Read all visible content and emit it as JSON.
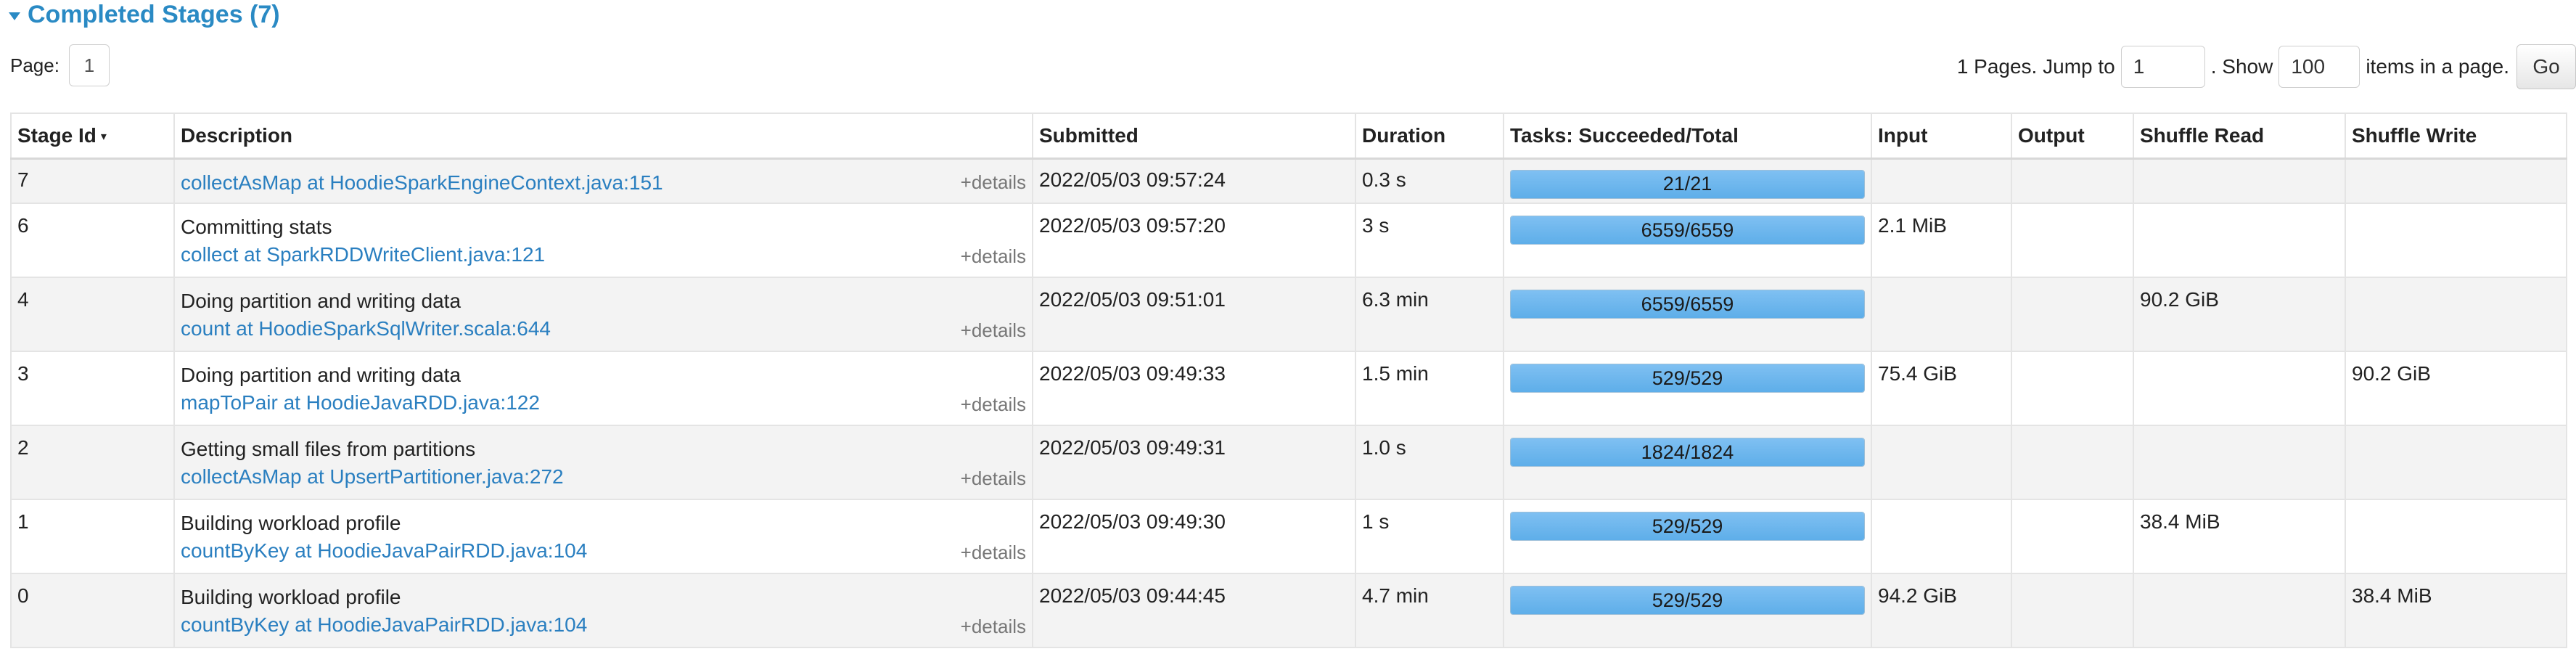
{
  "section": {
    "title": "Completed Stages (7)"
  },
  "pager": {
    "page_label": "Page:",
    "current_page": "1",
    "pages_text": "1 Pages. Jump to",
    "jump_value": "1",
    "show_text": ". Show",
    "show_value": "100",
    "items_text": "items in a page.",
    "go_label": "Go"
  },
  "table": {
    "headers": {
      "stage_id": "Stage Id",
      "sort_indicator": "▾",
      "description": "Description",
      "submitted": "Submitted",
      "duration": "Duration",
      "tasks": "Tasks: Succeeded/Total",
      "input": "Input",
      "output": "Output",
      "shuffle_read": "Shuffle Read",
      "shuffle_write": "Shuffle Write"
    },
    "details_label": "+details",
    "rows": [
      {
        "stage_id": "7",
        "title": "",
        "link": "collectAsMap at HoodieSparkEngineContext.java:151",
        "submitted": "2022/05/03 09:57:24",
        "duration": "0.3 s",
        "tasks": "21/21",
        "progress": 1.0,
        "input": "",
        "output": "",
        "shuffle_read": "",
        "shuffle_write": ""
      },
      {
        "stage_id": "6",
        "title": "Committing stats",
        "link": "collect at SparkRDDWriteClient.java:121",
        "submitted": "2022/05/03 09:57:20",
        "duration": "3 s",
        "tasks": "6559/6559",
        "progress": 1.0,
        "input": "2.1 MiB",
        "output": "",
        "shuffle_read": "",
        "shuffle_write": ""
      },
      {
        "stage_id": "4",
        "title": "Doing partition and writing data",
        "link": "count at HoodieSparkSqlWriter.scala:644",
        "submitted": "2022/05/03 09:51:01",
        "duration": "6.3 min",
        "tasks": "6559/6559",
        "progress": 1.0,
        "input": "",
        "output": "",
        "shuffle_read": "90.2 GiB",
        "shuffle_write": ""
      },
      {
        "stage_id": "3",
        "title": "Doing partition and writing data",
        "link": "mapToPair at HoodieJavaRDD.java:122",
        "submitted": "2022/05/03 09:49:33",
        "duration": "1.5 min",
        "tasks": "529/529",
        "progress": 1.0,
        "input": "75.4 GiB",
        "output": "",
        "shuffle_read": "",
        "shuffle_write": "90.2 GiB"
      },
      {
        "stage_id": "2",
        "title": "Getting small files from partitions",
        "link": "collectAsMap at UpsertPartitioner.java:272",
        "submitted": "2022/05/03 09:49:31",
        "duration": "1.0 s",
        "tasks": "1824/1824",
        "progress": 1.0,
        "input": "",
        "output": "",
        "shuffle_read": "",
        "shuffle_write": ""
      },
      {
        "stage_id": "1",
        "title": "Building workload profile",
        "link": "countByKey at HoodieJavaPairRDD.java:104",
        "submitted": "2022/05/03 09:49:30",
        "duration": "1 s",
        "tasks": "529/529",
        "progress": 1.0,
        "input": "",
        "output": "",
        "shuffle_read": "38.4 MiB",
        "shuffle_write": ""
      },
      {
        "stage_id": "0",
        "title": "Building workload profile",
        "link": "countByKey at HoodieJavaPairRDD.java:104",
        "submitted": "2022/05/03 09:44:45",
        "duration": "4.7 min",
        "tasks": "529/529",
        "progress": 1.0,
        "input": "94.2 GiB",
        "output": "",
        "shuffle_read": "",
        "shuffle_write": "38.4 MiB"
      }
    ]
  },
  "colors": {
    "accent": "#2a8ac4",
    "link": "#2a7fc0",
    "bar": "#6cb6ee"
  }
}
